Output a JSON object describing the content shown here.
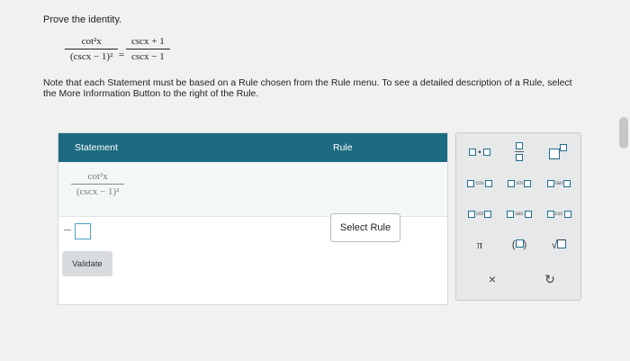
{
  "prompt": "Prove the identity.",
  "identity": {
    "lhs_num": "cot²x",
    "lhs_den": "(cscx − 1)²",
    "equals": "=",
    "rhs_num": "cscx + 1",
    "rhs_den": "cscx − 1"
  },
  "note": "Note that each Statement must be based on a Rule chosen from the Rule menu. To see a detailed description of a Rule, select the More Information Button to the right of the Rule.",
  "table": {
    "header_statement": "Statement",
    "header_rule": "Rule",
    "row1_num": "cot²x",
    "row1_den": "(cscx − 1)²",
    "select_rule_label": "Select Rule",
    "validate_label": "Validate"
  },
  "palette": {
    "mult": "□·□",
    "cos": "cos",
    "sin": "sin",
    "tan": "tan",
    "cot": "cot",
    "sec": "sec",
    "csc": "csc",
    "pi": "π",
    "paren": "(□)",
    "sqrt": "√□",
    "clear": "×",
    "reset": "↻"
  }
}
